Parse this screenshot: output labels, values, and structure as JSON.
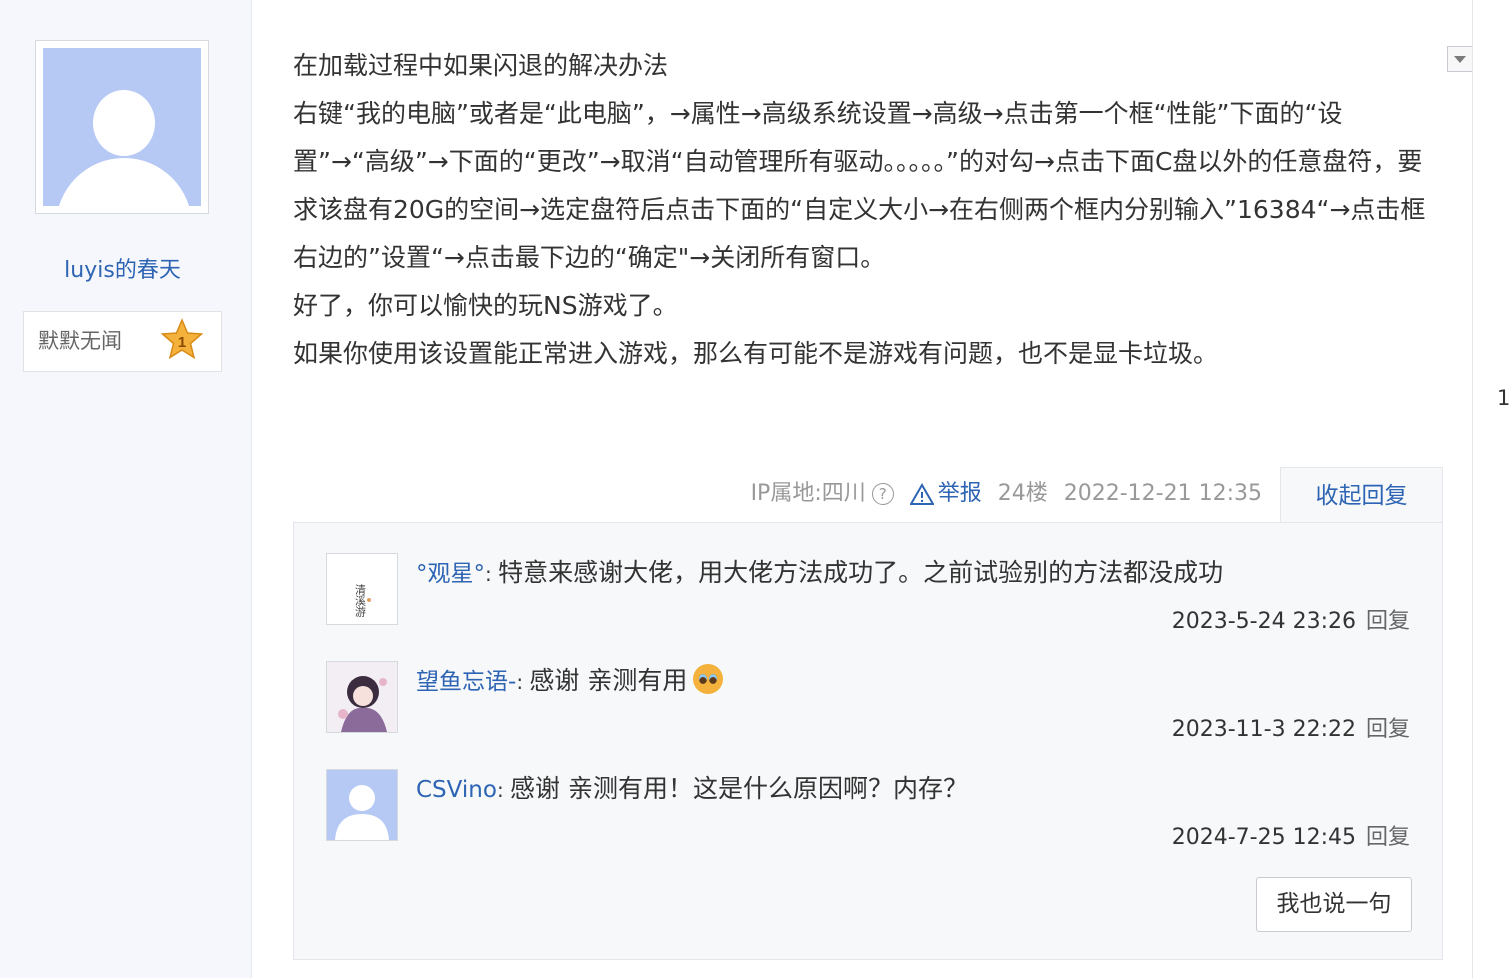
{
  "author": {
    "name": "luyis的春天",
    "level_title": "默默无闻",
    "level_number": "1"
  },
  "post": {
    "lines": [
      "在加载过程中如果闪退的解决办法",
      "右键“我的电脑”或者是“此电脑”，→属性→高级系统设置→高级→点击第一个框“性能”下面的“设置”→“高级”→下面的“更改”→取消“自动管理所有驱动。。。。。”的对勾→点击下面C盘以外的任意盘符，要求该盘有20G的空间→选定盘符后点击下面的“自定义大小→在右侧两个框内分别输入”16384“→点击框右边的”设置“→点击最下边的“确定\"→关闭所有窗口。",
      "好了，你可以愉快的玩NS游戏了。",
      "如果你使用该设置能正常进入游戏，那么有可能不是游戏有问题，也不是显卡垃圾。"
    ],
    "ip_location": "IP属地:四川",
    "report_label": "举报",
    "floor": "24楼",
    "timestamp": "2022-12-21 12:35",
    "collapse_label": "收起回复"
  },
  "replies": [
    {
      "user": "°观星°",
      "text": "特意来感谢大佬，用大佬方法成功了。之前试验别的方法都没成功",
      "time": "2023-5-24 23:26",
      "reply_label": "回复",
      "avatar_text": "清溪游"
    },
    {
      "user": "望鱼忘语-",
      "text": "感谢 亲测有用",
      "time": "2023-11-3 22:22",
      "reply_label": "回复"
    },
    {
      "user": "CSVino",
      "text": "感谢 亲测有用！这是什么原因啊？内存？",
      "time": "2024-7-25 12:45",
      "reply_label": "回复"
    }
  ],
  "say_button_label": "我也说一句",
  "page_number": "1",
  "colors": {
    "link": "#2d64b3",
    "sidebar_bg": "#f5f7fc",
    "reply_panel_bg": "#f7f8fa",
    "avatar_bg": "#b6c9f5",
    "star": "#f4b23c"
  }
}
